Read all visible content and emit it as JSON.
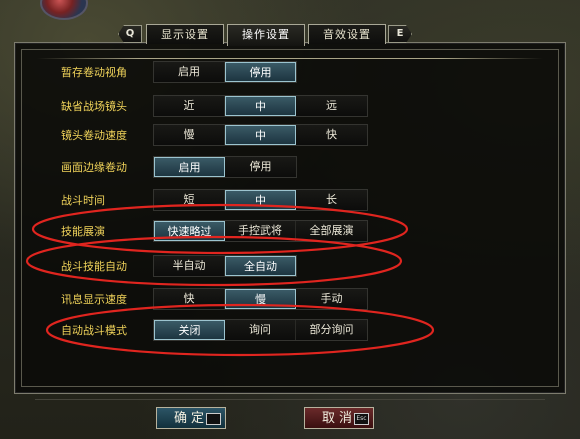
{
  "tabs": {
    "left_key": "Q",
    "right_key": "E",
    "items": [
      {
        "label": "显示设置",
        "active": false
      },
      {
        "label": "操作设置",
        "active": true
      },
      {
        "label": "音效设置",
        "active": false
      }
    ]
  },
  "settings": [
    {
      "label": "暂存卷动视角",
      "options": [
        "启用",
        "停用"
      ],
      "selected": 1
    },
    {
      "label": "缺省战场镜头",
      "options": [
        "近",
        "中",
        "远"
      ],
      "selected": 1
    },
    {
      "label": "镜头卷动速度",
      "options": [
        "慢",
        "中",
        "快"
      ],
      "selected": 1
    },
    {
      "label": "画面边缘卷动",
      "options": [
        "启用",
        "停用"
      ],
      "selected": 0
    },
    {
      "label": "战斗时间",
      "options": [
        "短",
        "中",
        "长"
      ],
      "selected": 1
    },
    {
      "label": "技能展演",
      "options": [
        "快速略过",
        "手控武将",
        "全部展演"
      ],
      "selected": 0
    },
    {
      "label": "战斗技能自动",
      "options": [
        "半自动",
        "全自动"
      ],
      "selected": 1
    },
    {
      "label": "讯息显示速度",
      "options": [
        "快",
        "慢",
        "手动"
      ],
      "selected": 1
    },
    {
      "label": "自动战斗模式",
      "options": [
        "关闭",
        "询问",
        "部分询问"
      ],
      "selected": 0
    }
  ],
  "buttons": {
    "ok_label": "确定",
    "ok_key": "",
    "cancel_label": "取消",
    "cancel_key": "Esc"
  },
  "colors": {
    "label": "#f0d35a",
    "selected_fill": "#2c4a56",
    "selected_border": "#9cc4cf",
    "annotation": "#e0251f"
  }
}
